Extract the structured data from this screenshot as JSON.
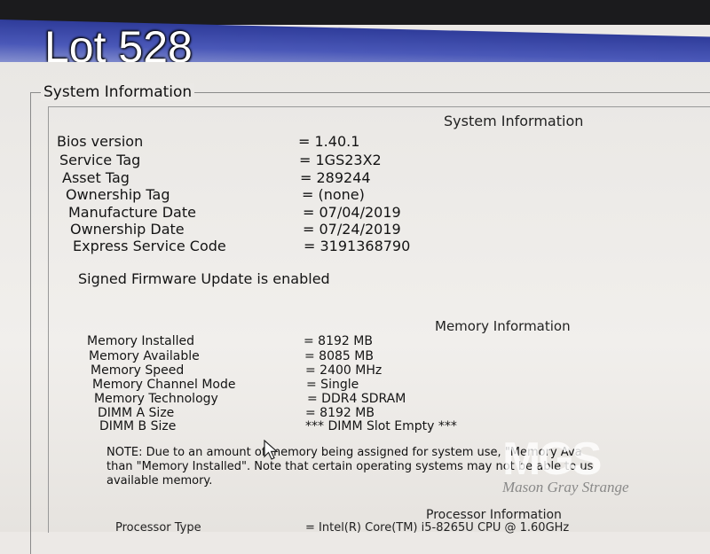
{
  "overlay": {
    "lot_label": "Lot 528"
  },
  "group_title": "System Information",
  "system": {
    "title": "System Information",
    "rows": [
      {
        "label": "Bios version",
        "value": "= 1.40.1"
      },
      {
        "label": "Service Tag",
        "value": "= 1GS23X2"
      },
      {
        "label": "Asset Tag",
        "value": "= 289244"
      },
      {
        "label": "Ownership Tag",
        "value": "= (none)"
      },
      {
        "label": "Manufacture Date",
        "value": "= 07/04/2019"
      },
      {
        "label": "Ownership Date",
        "value": "= 07/24/2019"
      },
      {
        "label": "Express Service Code",
        "value": "= 3191368790"
      }
    ],
    "firmware_note": "Signed Firmware Update is enabled"
  },
  "memory": {
    "title": "Memory Information",
    "rows": [
      {
        "label": "Memory Installed",
        "value": "= 8192 MB"
      },
      {
        "label": "Memory Available",
        "value": "= 8085 MB"
      },
      {
        "label": "Memory Speed",
        "value": "= 2400 MHz"
      },
      {
        "label": "Memory Channel Mode",
        "value": "= Single"
      },
      {
        "label": "Memory Technology",
        "value": "= DDR4 SDRAM"
      },
      {
        "label": "DIMM A Size",
        "value": "= 8192 MB"
      },
      {
        "label": "DIMM B Size",
        "value": "*** DIMM Slot Empty ***"
      }
    ],
    "note_lines": [
      "NOTE: Due to an amount of memory being assigned for system use, \"Memory Ava",
      "than \"Memory Installed\". Note that certain operating systems may not be able to us",
      "available memory."
    ]
  },
  "processor": {
    "title": "Processor Information",
    "row": {
      "label": "Processor Type",
      "value": "= Intel(R) Core(TM) i5-8265U CPU @ 1.60GHz"
    }
  },
  "watermark": {
    "logo_text": "MGS",
    "name": "Mason Gray Strange"
  }
}
